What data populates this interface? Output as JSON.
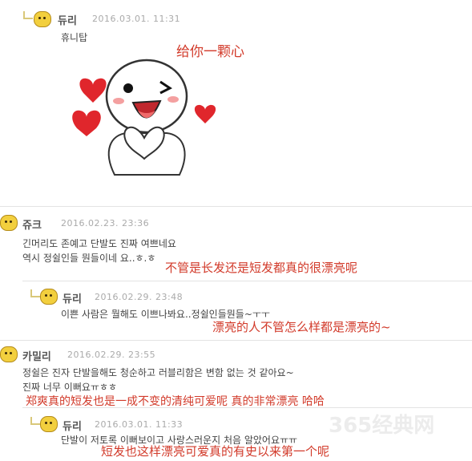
{
  "comments": [
    {
      "name": "듀리",
      "date": "2016.03.01. 11:31",
      "lines": [
        "휴니탑"
      ]
    },
    {
      "name": "쥬크",
      "date": "2016.02.23. 23:36",
      "lines": [
        "긴머리도 존예고 단발도 진짜 여쁘네요",
        "역시 정쉴인들 뭔들이네 요..ㅎ.ㅎ"
      ]
    },
    {
      "name": "듀리",
      "date": "2016.02.29. 23:48",
      "lines": [
        "이쁜 사람은 뭘해도 이쁘나봐요..정쉴인들뭔들~ㅜㅜ"
      ]
    },
    {
      "name": "카밀리",
      "date": "2016.02.29. 23:55",
      "lines": [
        "정쉴은 진자 단발을해도 청순하고 러블리함은 변함 없는 것 같아요~",
        "진짜 너무 이뻐요ㅠㅎㅎ"
      ]
    },
    {
      "name": "듀리",
      "date": "2016.03.01. 11:33",
      "lines": [
        "단발이 저토록 이뻐보이고 사랑스러운지 처음 알았어요ㅠㅠ"
      ]
    }
  ],
  "captions": [
    "给你一颗心",
    "不管是长发还是短发都真的很漂亮呢",
    "漂亮的人不管怎么样都是漂亮的~",
    "郑爽真的短发也是一成不变的清纯可爱呢 真的非常漂亮 哈哈",
    "短发也这样漂亮可爱真的有史以来第一个呢"
  ],
  "watermark": "365经典网",
  "colors": {
    "caption": "#d23a2a",
    "heart": "#e0262c",
    "avatar": "#f2cf3e"
  },
  "icons": [
    "reply-arrow-icon",
    "avatar-icon",
    "heart-icon"
  ]
}
